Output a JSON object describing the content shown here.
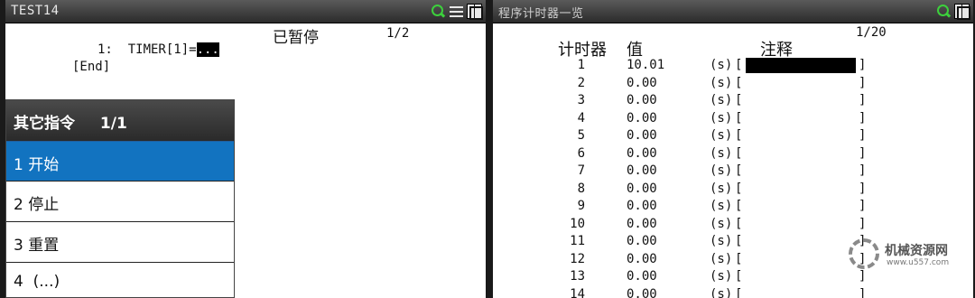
{
  "left_window": {
    "title": "TEST14",
    "program_lines": [
      {
        "num": "1:",
        "text": "TIMER[1]=",
        "cursor": "..."
      },
      {
        "text": "[End]"
      }
    ],
    "status": "已暂停",
    "page": "1/2"
  },
  "submenu": {
    "title": "其它指令",
    "page": "1/1",
    "items": [
      {
        "label": "1 开始",
        "selected": true
      },
      {
        "label": "2 停止",
        "selected": false
      },
      {
        "label": "3 重置",
        "selected": false
      },
      {
        "label": "4  (...)",
        "selected": false
      }
    ]
  },
  "right_window": {
    "title": "程序计时器一览",
    "page": "1/20",
    "columns": {
      "timer": "计时器",
      "value": "值",
      "comment": "注释"
    },
    "rows": [
      {
        "idx": "1",
        "value": "10.01",
        "unit": "(s)",
        "bracket_l": "[",
        "bracket_r": "]"
      },
      {
        "idx": "2",
        "value": "0.00",
        "unit": "(s)",
        "bracket_l": "[",
        "bracket_r": "]"
      },
      {
        "idx": "3",
        "value": "0.00",
        "unit": "(s)",
        "bracket_l": "[",
        "bracket_r": "]"
      },
      {
        "idx": "4",
        "value": "0.00",
        "unit": "(s)",
        "bracket_l": "[",
        "bracket_r": "]"
      },
      {
        "idx": "5",
        "value": "0.00",
        "unit": "(s)",
        "bracket_l": "[",
        "bracket_r": "]"
      },
      {
        "idx": "6",
        "value": "0.00",
        "unit": "(s)",
        "bracket_l": "[",
        "bracket_r": "]"
      },
      {
        "idx": "7",
        "value": "0.00",
        "unit": "(s)",
        "bracket_l": "[",
        "bracket_r": "]"
      },
      {
        "idx": "8",
        "value": "0.00",
        "unit": "(s)",
        "bracket_l": "[",
        "bracket_r": "]"
      },
      {
        "idx": "9",
        "value": "0.00",
        "unit": "(s)",
        "bracket_l": "[",
        "bracket_r": "]"
      },
      {
        "idx": "10",
        "value": "0.00",
        "unit": "(s)",
        "bracket_l": "[",
        "bracket_r": "]"
      },
      {
        "idx": "11",
        "value": "0.00",
        "unit": "(s)",
        "bracket_l": "[",
        "bracket_r": "]"
      },
      {
        "idx": "12",
        "value": "0.00",
        "unit": "(s)",
        "bracket_l": "[",
        "bracket_r": "]"
      },
      {
        "idx": "13",
        "value": "0.00",
        "unit": "(s)",
        "bracket_l": "[",
        "bracket_r": "]"
      },
      {
        "idx": "14",
        "value": "0.00",
        "unit": "(s)",
        "bracket_l": "[",
        "bracket_r": "]"
      }
    ]
  },
  "watermark": {
    "name": "机械资源网",
    "url": "www.u557.com"
  },
  "icons": {
    "zoom": "zoom-icon",
    "menu": "menu-icon",
    "maximize": "maximize-icon"
  },
  "colors": {
    "selected": "#1273c0",
    "zoom_icon": "#3cd03c"
  }
}
